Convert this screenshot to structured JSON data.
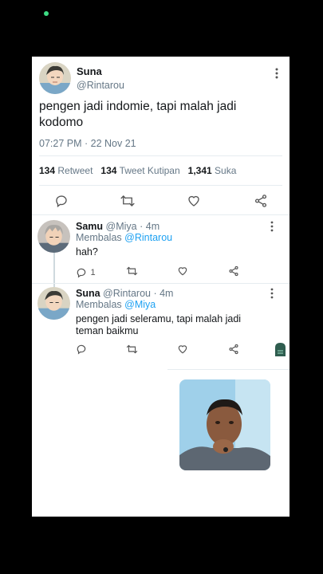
{
  "main_tweet": {
    "author_name": "Suna",
    "author_handle": "@Rintarou",
    "text": "pengen jadi indomie, tapi malah jadi kodomo",
    "timestamp": "07:27 PM · 22 Nov 21",
    "retweets_count": "134",
    "retweets_label": "Retweet",
    "quotes_count": "134",
    "quotes_label": "Tweet Kutipan",
    "likes_count": "1,341",
    "likes_label": "Suka"
  },
  "replies": [
    {
      "author_name": "Samu",
      "author_handle": "@Miya",
      "time": "· 4m",
      "replying_prefix": "Membalas",
      "replying_to": "@Rintarou",
      "text": "hah?",
      "reply_count": "1"
    },
    {
      "author_name": "Suna",
      "author_handle": "@Rintarou",
      "time": "· 4m",
      "replying_prefix": "Membalas",
      "replying_to": "@Miya",
      "text": "pengen jadi seleramu, tapi malah jadi teman baikmu",
      "reply_count": ""
    }
  ],
  "colors": {
    "accent": "#1da1f2",
    "muted": "#657786",
    "divider": "#e6ecf0"
  },
  "icons": [
    "reply-icon",
    "retweet-icon",
    "like-icon",
    "share-icon",
    "more-icon"
  ]
}
